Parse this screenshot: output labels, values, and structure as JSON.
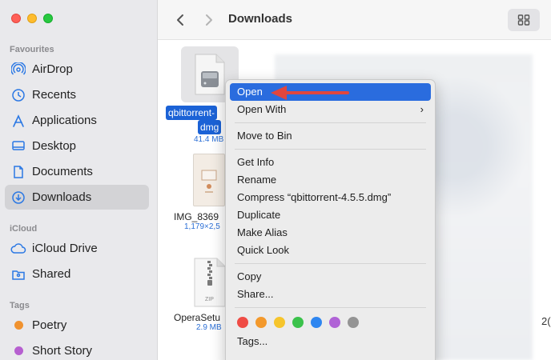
{
  "window": {
    "title": "Downloads"
  },
  "sidebar": {
    "favourites_title": "Favourites",
    "favourites": [
      {
        "label": "AirDrop",
        "icon": "airdrop-icon"
      },
      {
        "label": "Recents",
        "icon": "clock-icon"
      },
      {
        "label": "Applications",
        "icon": "applications-icon"
      },
      {
        "label": "Desktop",
        "icon": "desktop-icon"
      },
      {
        "label": "Documents",
        "icon": "document-icon"
      },
      {
        "label": "Downloads",
        "icon": "download-icon",
        "active": true
      }
    ],
    "icloud_title": "iCloud",
    "icloud": [
      {
        "label": "iCloud Drive",
        "icon": "cloud-icon"
      },
      {
        "label": "Shared",
        "icon": "shared-folder-icon"
      }
    ],
    "tags_title": "Tags",
    "tags": [
      {
        "label": "Poetry",
        "color": "#f0922f"
      },
      {
        "label": "Short Story",
        "color": "#b65fd0"
      }
    ]
  },
  "files": [
    {
      "name_line1": "qbittorrent-",
      "name_line2": "dmg",
      "meta": "41.4 MB"
    },
    {
      "name": "IMG_8369",
      "meta": "1,179×2,5"
    },
    {
      "name": "OperaSetu",
      "meta": "2.9 MB",
      "badge": "ZIP"
    }
  ],
  "edge_text": "2(",
  "context_menu": {
    "open": "Open",
    "open_with": "Open With",
    "move_to_bin": "Move to Bin",
    "get_info": "Get Info",
    "rename": "Rename",
    "compress": "Compress “qbittorrent-4.5.5.dmg”",
    "duplicate": "Duplicate",
    "make_alias": "Make Alias",
    "quick_look": "Quick Look",
    "copy": "Copy",
    "share": "Share...",
    "tags": "Tags...",
    "tag_colors": [
      "#ef4c45",
      "#f3992c",
      "#f6c52c",
      "#3bc24b",
      "#2e86f0",
      "#b063d6",
      "#949494"
    ]
  },
  "accent_color": "#2a6cde"
}
